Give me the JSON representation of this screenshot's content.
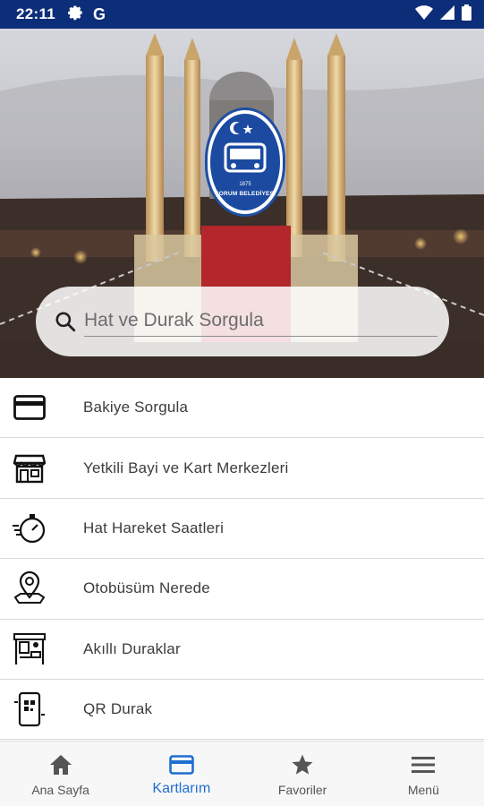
{
  "status_bar": {
    "time": "22:11",
    "left_icons": [
      "gear-icon",
      "google-icon"
    ],
    "google_letter": "G",
    "right_icons": [
      "wifi-icon",
      "cellular-signal-icon",
      "battery-icon"
    ],
    "background": "#0c2d78"
  },
  "hero": {
    "logo": {
      "year": "1875",
      "text": "ÇORUM BELEDİYESİ"
    },
    "search": {
      "placeholder": "Hat ve Durak Sorgula"
    }
  },
  "menu": {
    "items": [
      {
        "label": "Bakiye Sorgula",
        "icon": "credit-card-icon"
      },
      {
        "label": "Yetkili Bayi ve Kart Merkezleri",
        "icon": "store-icon"
      },
      {
        "label": "Hat Hareket Saatleri",
        "icon": "stopwatch-icon"
      },
      {
        "label": "Otobüsüm Nerede",
        "icon": "map-pin-icon"
      },
      {
        "label": "Akıllı Duraklar",
        "icon": "bus-stop-icon"
      },
      {
        "label": "QR Durak",
        "icon": "qr-phone-icon"
      }
    ]
  },
  "bottom_nav": {
    "items": [
      {
        "label": "Ana Sayfa",
        "icon": "home-icon",
        "active": false
      },
      {
        "label": "Kartlarım",
        "icon": "card-icon",
        "active": true
      },
      {
        "label": "Favoriler",
        "icon": "star-icon",
        "active": false
      },
      {
        "label": "Menü",
        "icon": "hamburger-icon",
        "active": false
      }
    ],
    "active_color": "#1f6fd0",
    "inactive_color": "#555555"
  }
}
